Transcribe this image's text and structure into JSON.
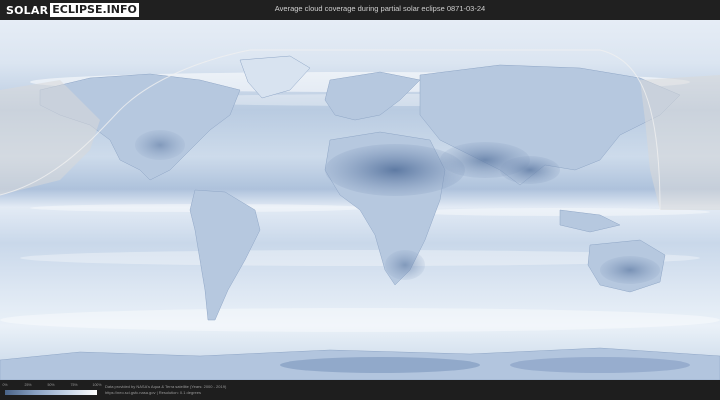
{
  "header": {
    "logo_left": "SOLAR",
    "logo_right": "ECLIPSE.INFO",
    "title": "Average cloud coverage during partial solar eclipse 0871-03-24"
  },
  "map": {
    "type": "world cloud coverage map",
    "eclipse_visibility_overlay": true
  },
  "legend": {
    "ticks": [
      "0%",
      "25%",
      "50%",
      "75%",
      "100%"
    ],
    "colors": {
      "clear": "#4a6488",
      "cloudy": "#ffffff"
    }
  },
  "footer": {
    "credit_line1": "Data provided by NASA's Aqua & Terra satellite (Years: 2000 - 2019)",
    "credit_line2": "https://neo.sci.gsfc.nasa.gov | Resolution: 0.1 degrees"
  }
}
